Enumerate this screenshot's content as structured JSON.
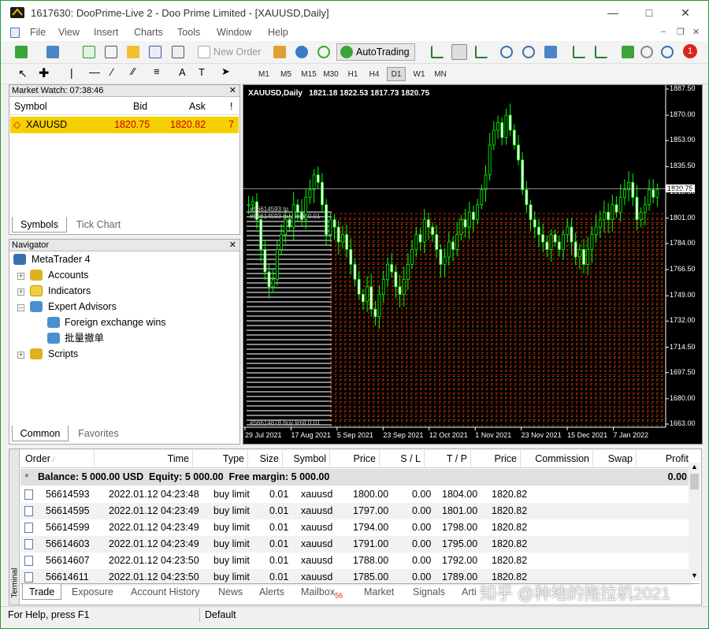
{
  "window": {
    "title": "1617630: DooPrime-Live 2 - Doo Prime Limited - [XAUUSD,Daily]"
  },
  "menu": [
    "File",
    "View",
    "Insert",
    "Charts",
    "Tools",
    "Window",
    "Help"
  ],
  "toolbar": {
    "new_order": "New Order",
    "autotrading": "AutoTrading"
  },
  "timeframes": [
    "M1",
    "M5",
    "M15",
    "M30",
    "H1",
    "H4",
    "D1",
    "W1",
    "MN"
  ],
  "active_timeframe": "D1",
  "notification_badge": "1",
  "market_watch": {
    "header": "Market Watch: 07:38:46",
    "cols": [
      "Symbol",
      "Bid",
      "Ask",
      "!"
    ],
    "rows": [
      {
        "symbol": "XAUUSD",
        "bid": "1820.75",
        "ask": "1820.82",
        "spread": "7"
      }
    ],
    "tabs": [
      "Symbols",
      "Tick Chart"
    ]
  },
  "navigator": {
    "header": "Navigator",
    "root": "MetaTrader 4",
    "items": [
      "Accounts",
      "Indicators",
      "Expert Advisors",
      "Foreign exchange wins",
      "批量撤单",
      "Scripts"
    ],
    "tabs": [
      "Common",
      "Favorites"
    ]
  },
  "chart": {
    "title": "XAUUSD,Daily",
    "ohlc": "1821.18 1822.53 1817.73 1820.75",
    "current_price": "1820.75",
    "order_label_top": "#56614593 tp",
    "order_label_buy": "#56614593 buy limit 0.01",
    "order_label_bottom": "#56614878 buy limit 0.01",
    "price_labels": [
      "1887.50",
      "1870.00",
      "1853.00",
      "1835.50",
      "1818.50",
      "1801.00",
      "1784.00",
      "1766.50",
      "1749.00",
      "1732.00",
      "1714.50",
      "1697.50",
      "1680.00",
      "1663.00"
    ],
    "date_labels": [
      "29 Jul 2021",
      "17 Aug 2021",
      "5 Sep 2021",
      "23 Sep 2021",
      "12 Oct 2021",
      "1 Nov 2021",
      "23 Nov 2021",
      "15 Dec 2021",
      "7 Jan 2022"
    ],
    "colors": {
      "candle": "#00ff00",
      "background": "#000000",
      "sell_line": "#ff0000",
      "buy_line": "#ff8c00"
    }
  },
  "terminal": {
    "side_label": "Terminal",
    "cols": [
      "Order",
      "Time",
      "Type",
      "Size",
      "Symbol",
      "Price",
      "S / L",
      "T / P",
      "Price",
      "Commission",
      "Swap",
      "Profit"
    ],
    "balance_line": "Balance: 5 000.00 USD  Equity: 5 000.00  Free margin: 5 000.00",
    "balance_profit": "0.00",
    "rows": [
      {
        "order": "56614593",
        "time": "2022.01.12 04:23:48",
        "type": "buy limit",
        "size": "0.01",
        "symbol": "xauusd",
        "price": "1800.00",
        "sl": "0.00",
        "tp": "1804.00",
        "cur": "1820.82"
      },
      {
        "order": "56614595",
        "time": "2022.01.12 04:23:49",
        "type": "buy limit",
        "size": "0.01",
        "symbol": "xauusd",
        "price": "1797.00",
        "sl": "0.00",
        "tp": "1801.00",
        "cur": "1820.82"
      },
      {
        "order": "56614599",
        "time": "2022.01.12 04:23:49",
        "type": "buy limit",
        "size": "0.01",
        "symbol": "xauusd",
        "price": "1794.00",
        "sl": "0.00",
        "tp": "1798.00",
        "cur": "1820.82"
      },
      {
        "order": "56614603",
        "time": "2022.01.12 04:23:49",
        "type": "buy limit",
        "size": "0.01",
        "symbol": "xauusd",
        "price": "1791.00",
        "sl": "0.00",
        "tp": "1795.00",
        "cur": "1820.82"
      },
      {
        "order": "56614607",
        "time": "2022.01.12 04:23:50",
        "type": "buy limit",
        "size": "0.01",
        "symbol": "xauusd",
        "price": "1788.00",
        "sl": "0.00",
        "tp": "1792.00",
        "cur": "1820.82"
      },
      {
        "order": "56614611",
        "time": "2022.01.12 04:23:50",
        "type": "buy limit",
        "size": "0.01",
        "symbol": "xauusd",
        "price": "1785.00",
        "sl": "0.00",
        "tp": "1789.00",
        "cur": "1820.82"
      }
    ],
    "tabs": [
      "Trade",
      "Exposure",
      "Account History",
      "News",
      "Alerts",
      "Mailbox",
      "Market",
      "Signals",
      "Arti"
    ],
    "mailbox_badge": "56"
  },
  "watermark": "知乎 @种地的拖拉机2021",
  "status": {
    "help": "For Help, press F1",
    "profile": "Default"
  }
}
